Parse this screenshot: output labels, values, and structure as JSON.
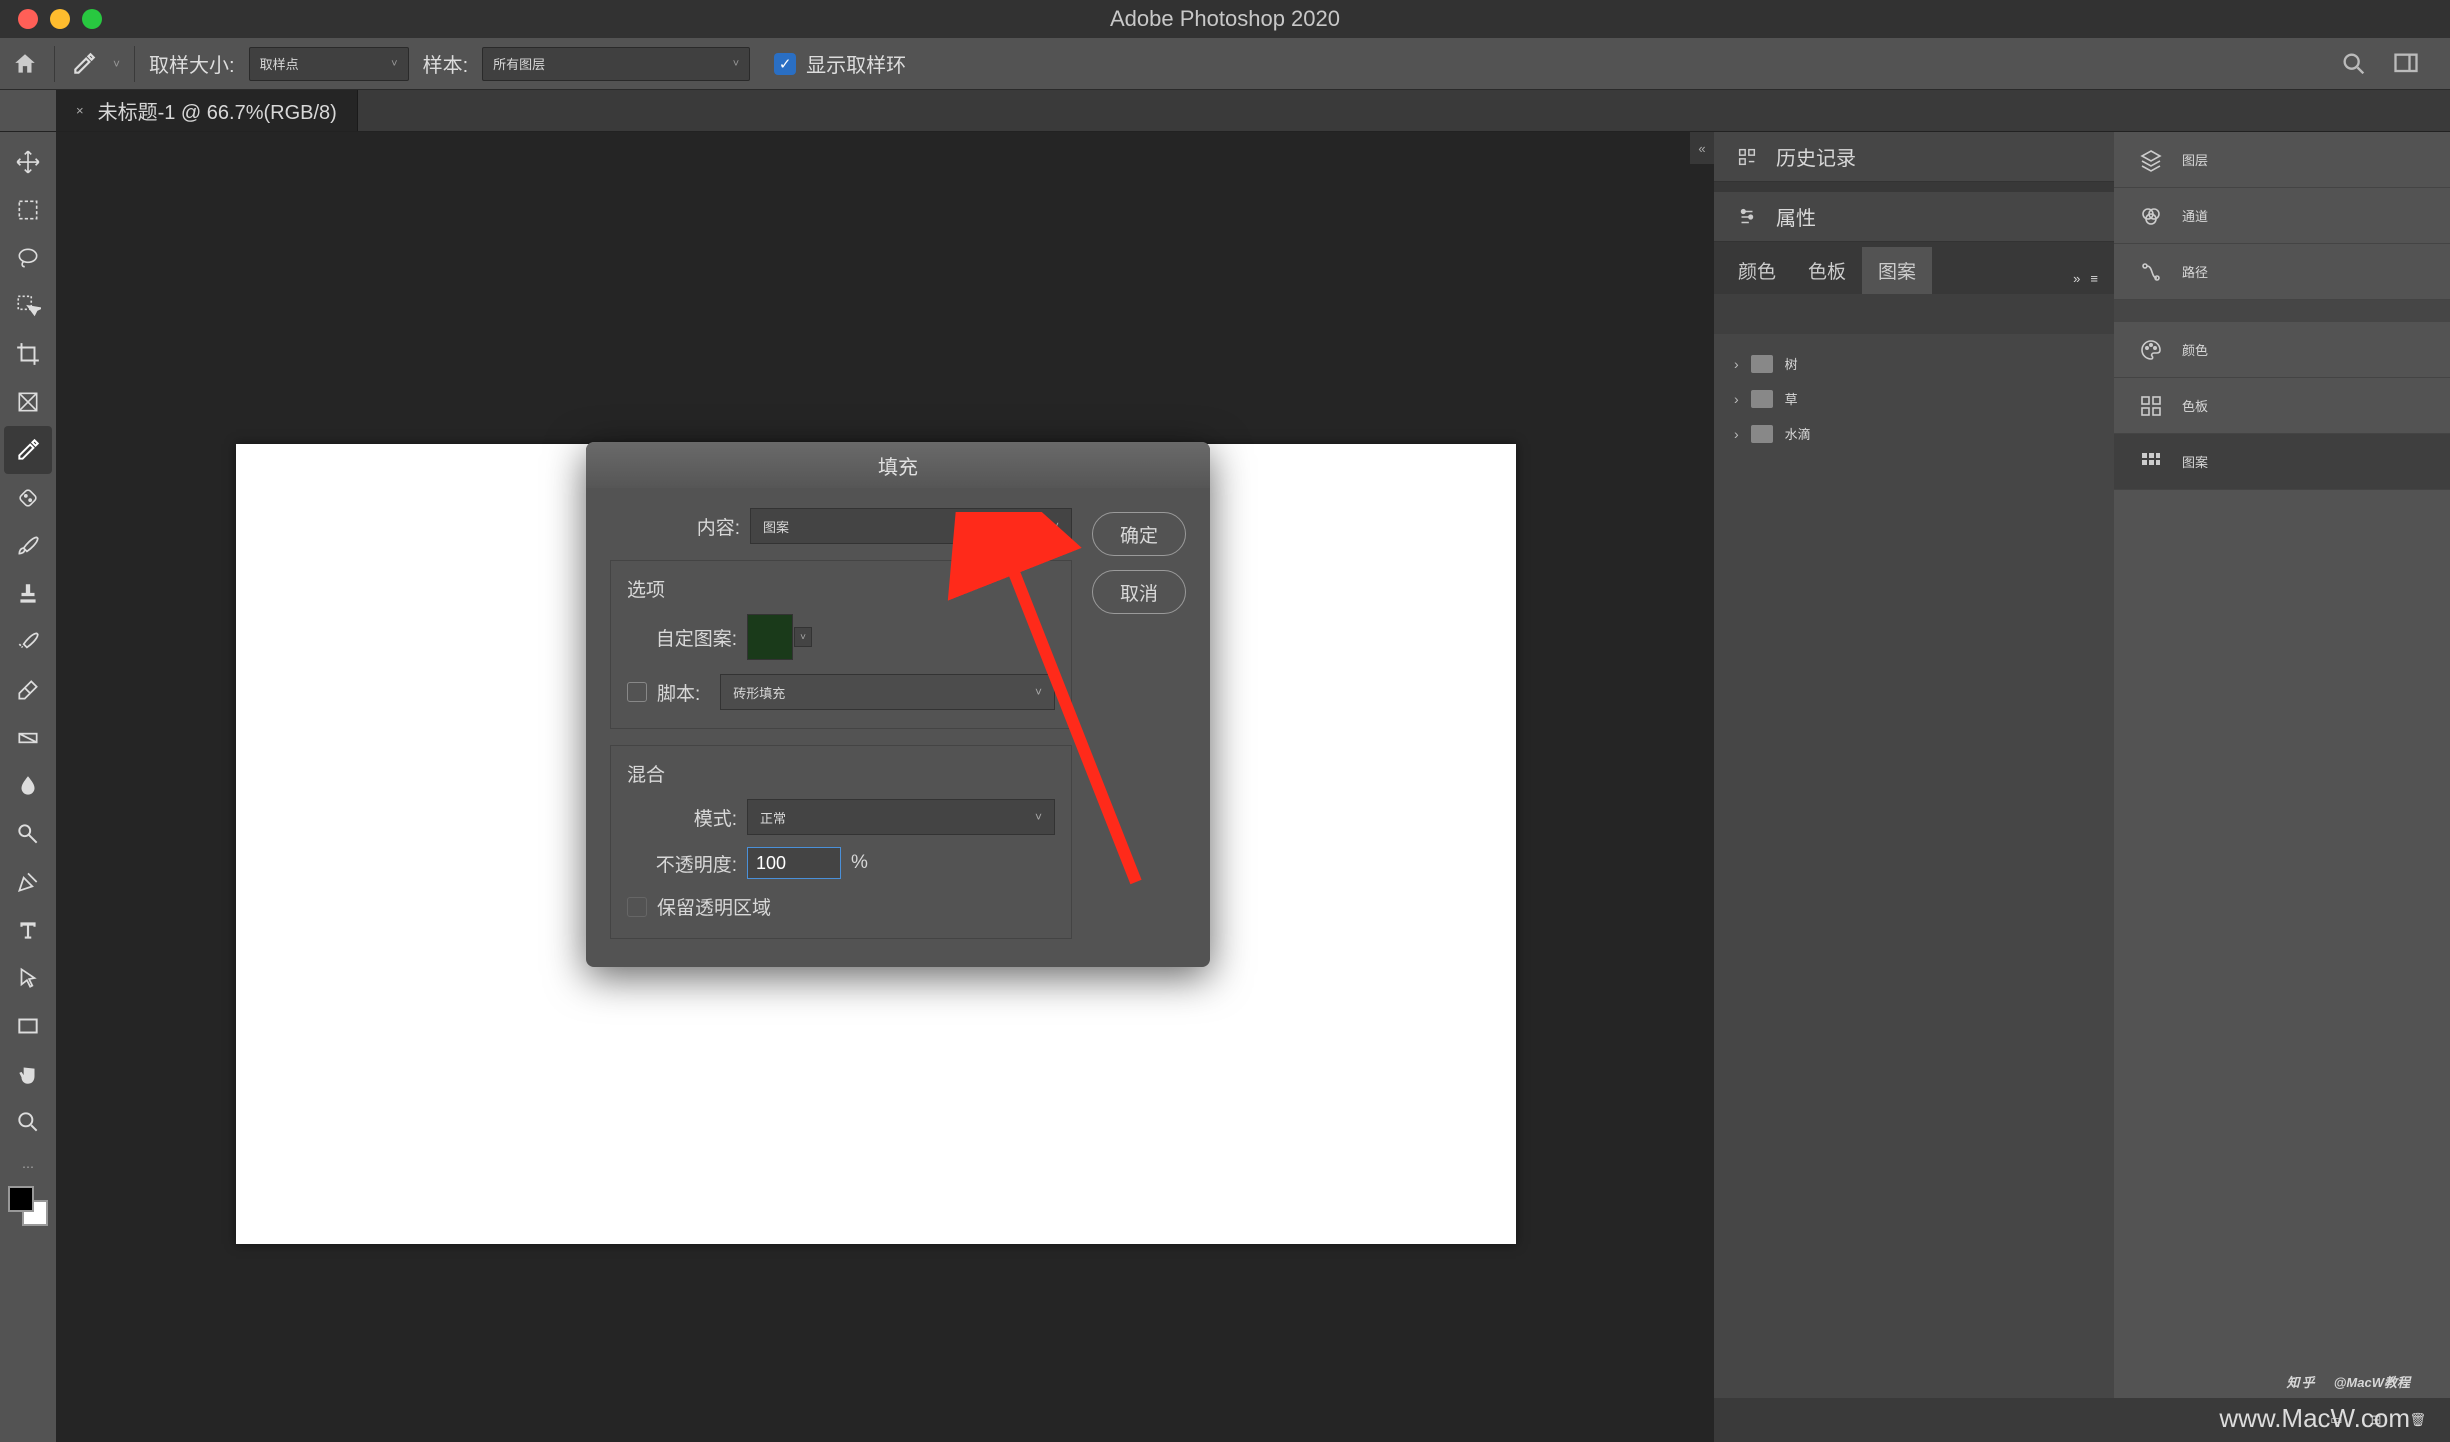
{
  "app": {
    "title": "Adobe Photoshop 2020"
  },
  "optbar": {
    "sample_size_label": "取样大小:",
    "sample_size_value": "取样点",
    "sample_label": "样本:",
    "sample_value": "所有图层",
    "show_ring_label": "显示取样环"
  },
  "doc_tab": {
    "close": "×",
    "title": "未标题-1 @ 66.7%(RGB/8)"
  },
  "panel1": {
    "history": "历史记录",
    "properties": "属性"
  },
  "pattern_tabs": {
    "color": "颜色",
    "swatches": "色板",
    "patterns": "图案"
  },
  "tree": {
    "items": [
      "树",
      "草",
      "水滴"
    ]
  },
  "panel2": {
    "layers": "图层",
    "channels": "通道",
    "paths": "路径",
    "color": "颜色",
    "swatches": "色板",
    "patterns": "图案"
  },
  "dialog": {
    "title": "填充",
    "content_label": "内容:",
    "content_value": "图案",
    "ok": "确定",
    "cancel": "取消",
    "options_title": "选项",
    "custom_pattern_label": "自定图案:",
    "script_label": "脚本:",
    "script_value": "砖形填充",
    "blend_title": "混合",
    "mode_label": "模式:",
    "mode_value": "正常",
    "opacity_label": "不透明度:",
    "opacity_value": "100",
    "percent": "%",
    "preserve_label": "保留透明区域"
  },
  "watermark": {
    "brand": "知乎",
    "author": "@MacW教程",
    "url": "www.MacW.com"
  }
}
